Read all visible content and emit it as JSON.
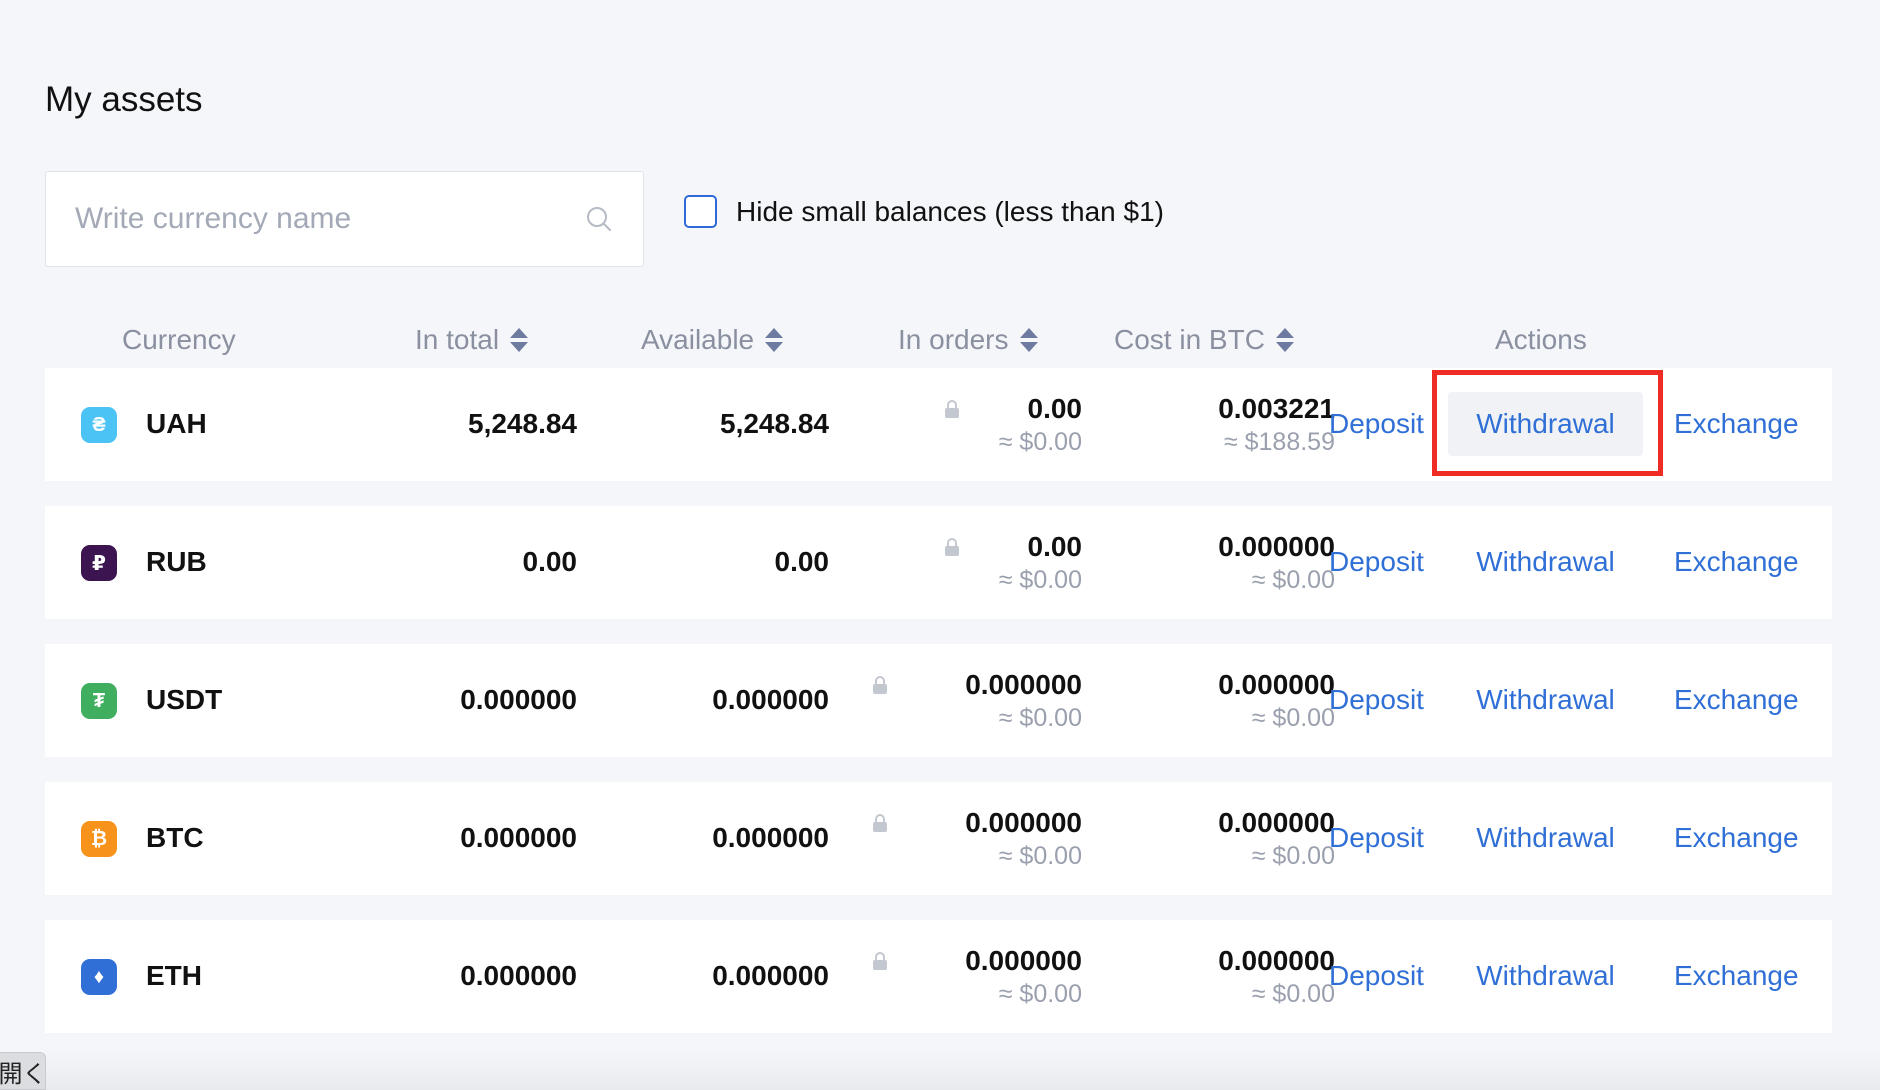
{
  "page": {
    "title": "My assets"
  },
  "search": {
    "placeholder": "Write currency name"
  },
  "hide_small": {
    "label": "Hide small balances (less than $1)",
    "checked": false
  },
  "columns": {
    "currency": "Currency",
    "in_total": "In total",
    "available": "Available",
    "in_orders": "In orders",
    "cost_btc": "Cost in BTC",
    "actions": "Actions"
  },
  "actions": {
    "deposit": "Deposit",
    "withdrawal": "Withdrawal",
    "exchange": "Exchange"
  },
  "rows": [
    {
      "symbol": "UAH",
      "icon": "hryvnia-icon",
      "icon_glyph": "₴",
      "icon_color": "#4cc3f5",
      "in_total": "5,248.84",
      "available": "5,248.84",
      "in_orders": "0.00",
      "in_orders_usd": "≈ $0.00",
      "cost_btc": "0.003221",
      "cost_usd": "≈ $188.59",
      "withdraw_active": true
    },
    {
      "symbol": "RUB",
      "icon": "ruble-icon",
      "icon_glyph": "₽",
      "icon_color": "#3b1450",
      "in_total": "0.00",
      "available": "0.00",
      "in_orders": "0.00",
      "in_orders_usd": "≈ $0.00",
      "cost_btc": "0.000000",
      "cost_usd": "≈ $0.00"
    },
    {
      "symbol": "USDT",
      "icon": "tether-icon",
      "icon_glyph": "₮",
      "icon_color": "#3fae5e",
      "in_total": "0.000000",
      "available": "0.000000",
      "in_orders": "0.000000",
      "in_orders_usd": "≈ $0.00",
      "cost_btc": "0.000000",
      "cost_usd": "≈ $0.00"
    },
    {
      "symbol": "BTC",
      "icon": "bitcoin-icon",
      "icon_glyph": "₿",
      "icon_color": "#f7931a",
      "in_total": "0.000000",
      "available": "0.000000",
      "in_orders": "0.000000",
      "in_orders_usd": "≈ $0.00",
      "cost_btc": "0.000000",
      "cost_usd": "≈ $0.00"
    },
    {
      "symbol": "ETH",
      "icon": "ethereum-icon",
      "icon_glyph": "♦",
      "icon_color": "#2f6fd6",
      "in_total": "0.000000",
      "available": "0.000000",
      "in_orders": "0.000000",
      "in_orders_usd": "≈ $0.00",
      "cost_btc": "0.000000",
      "cost_usd": "≈ $0.00"
    }
  ],
  "corner_tab": {
    "label": "開く"
  },
  "colors": {
    "accent": "#2f6fd6",
    "highlight": "#ee2b24",
    "muted": "#8a90a0"
  }
}
